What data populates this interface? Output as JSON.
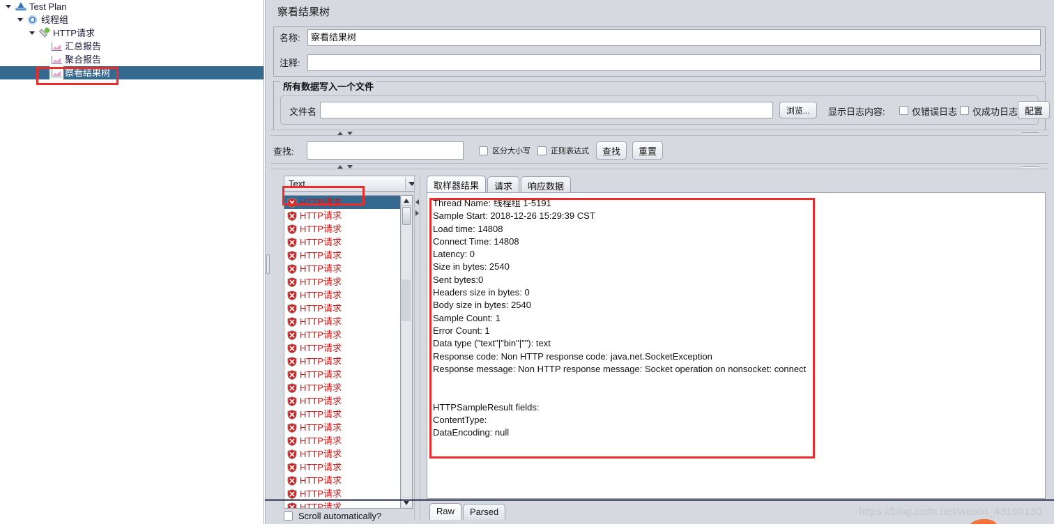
{
  "tree": {
    "items": [
      {
        "label": "Test Plan",
        "icon": "testplan-icon",
        "depth": 0,
        "toggle": true,
        "selected": false
      },
      {
        "label": "线程组",
        "icon": "gear-icon",
        "depth": 1,
        "toggle": true,
        "selected": false
      },
      {
        "label": "HTTP请求",
        "icon": "dropper-icon",
        "depth": 2,
        "toggle": true,
        "selected": false
      },
      {
        "label": "汇总报告",
        "icon": "chart-icon",
        "depth": 3,
        "toggle": false,
        "selected": false
      },
      {
        "label": "聚合报告",
        "icon": "chart-icon",
        "depth": 3,
        "toggle": false,
        "selected": false
      },
      {
        "label": "察看结果树",
        "icon": "chart-icon",
        "depth": 3,
        "toggle": false,
        "selected": true
      }
    ]
  },
  "panel": {
    "title": "察看结果树",
    "name_label": "名称:",
    "name_value": "察看结果树",
    "comment_label": "注释:",
    "comment_value": "",
    "group_title": "所有数据写入一个文件",
    "filename_label": "文件名",
    "filename_value": "",
    "browse_button": "浏览...",
    "log_display_label": "显示日志内容:",
    "errors_only_label": "仅错误日志",
    "success_only_label": "仅成功日志",
    "configure_button": "配置"
  },
  "search": {
    "label": "查找:",
    "value": "",
    "case_sensitive_label": "区分大小写",
    "regex_label": "正则表达式",
    "find_button": "查找",
    "reset_button": "重置"
  },
  "renderer": {
    "selected": "Text"
  },
  "results": {
    "item_label": "HTTP请求",
    "count": 24,
    "selected_index": 0,
    "status_icon": "error-shield-icon",
    "scroll_auto_label": "Scroll automatically?"
  },
  "tabs": {
    "items": [
      "取样器结果",
      "请求",
      "响应数据"
    ],
    "active_index": 0
  },
  "sampler_result": "Thread Name: 线程组 1-5191\nSample Start: 2018-12-26 15:29:39 CST\nLoad time: 14808\nConnect Time: 14808\nLatency: 0\nSize in bytes: 2540\nSent bytes:0\nHeaders size in bytes: 0\nBody size in bytes: 2540\nSample Count: 1\nError Count: 1\nData type (\"text\"|\"bin\"|\"\"): text\nResponse code: Non HTTP response code: java.net.SocketException\nResponse message: Non HTTP response message: Socket operation on nonsocket: connect\n\n\nHTTPSampleResult fields:\nContentType:\nDataEncoding: null",
  "bottom_tabs": {
    "items": [
      "Raw",
      "Parsed"
    ],
    "active_index": 0
  },
  "watermark": "https://blog.csdn.net/weixin_43160130",
  "colors": {
    "selection": "#36698f",
    "annotation": "#ec2b2b",
    "error_text": "#e20b0b",
    "panel_bg": "#d6d9e0"
  }
}
